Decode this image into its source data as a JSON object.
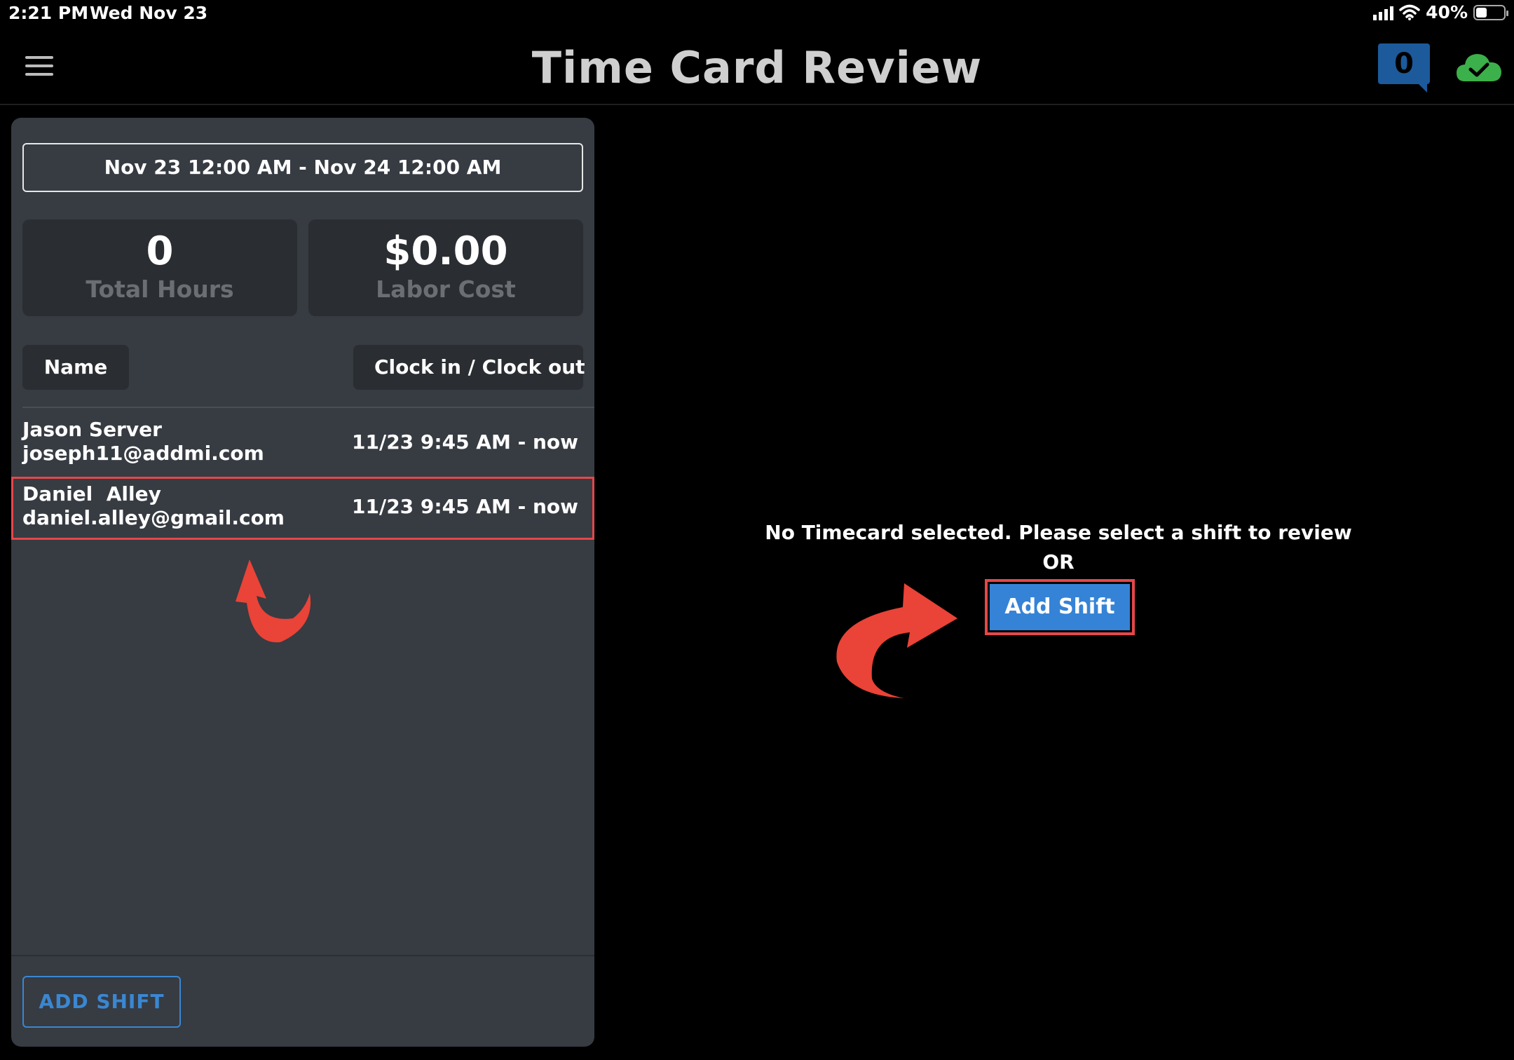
{
  "status_bar": {
    "time": "2:21 PM",
    "date": "Wed Nov 23",
    "battery_percent": "40%",
    "battery_level": 0.4
  },
  "header": {
    "title": "Time Card Review",
    "notification_count": "0",
    "sync_status_color": "#3cb04a"
  },
  "left_panel": {
    "date_range": "Nov 23 12:00 AM - Nov 24 12:00 AM",
    "stats": {
      "total_hours_value": "0",
      "total_hours_label": "Total Hours",
      "labor_cost_value": "$0.00",
      "labor_cost_label": "Labor Cost"
    },
    "columns": {
      "name": "Name",
      "clock": "Clock in / Clock out"
    },
    "rows": [
      {
        "name": "Jason Server",
        "email": "joseph11@addmi.com",
        "time": "11/23 9:45 AM - now"
      },
      {
        "name": "Daniel  Alley",
        "email": "daniel.alley@gmail.com",
        "time": "11/23 9:45 AM - now"
      }
    ],
    "add_shift_label": "ADD SHIFT"
  },
  "main": {
    "empty_message": "No Timecard selected. Please select a shift to review",
    "or_label": "OR",
    "add_shift_label": "Add Shift"
  },
  "colors": {
    "accent_blue": "#3583d6",
    "highlight_red": "#e5474a",
    "panel_bg": "#373b42"
  }
}
